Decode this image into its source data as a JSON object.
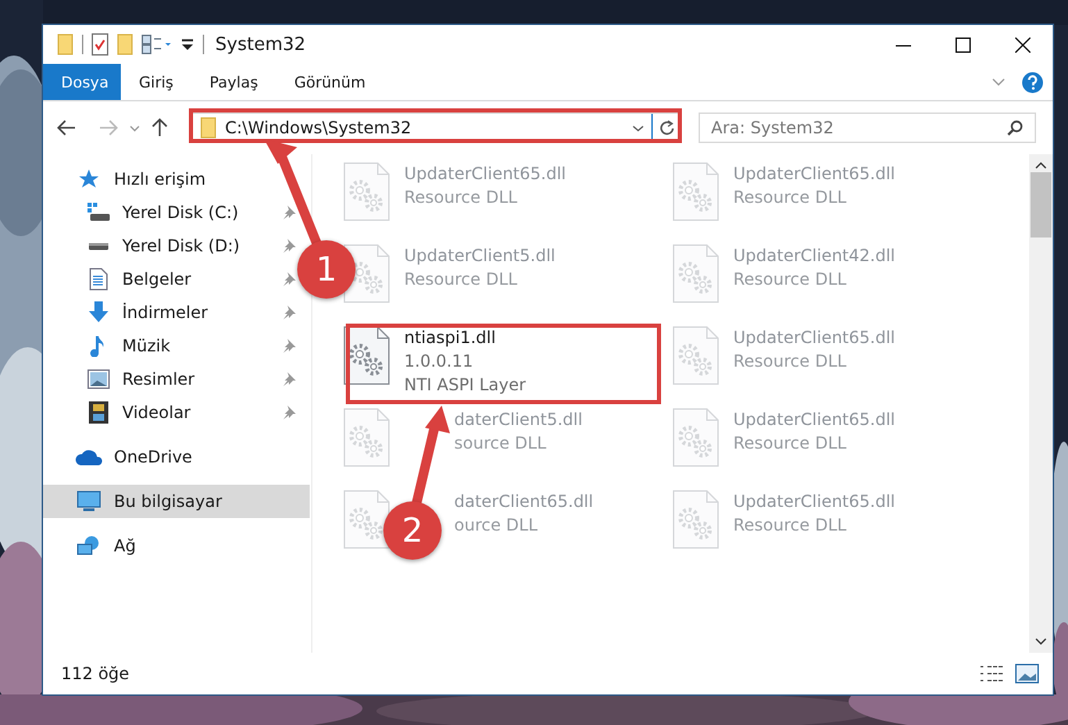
{
  "window": {
    "title": "System32"
  },
  "ribbon_tabs": [
    {
      "label": "Dosya",
      "selected": true
    },
    {
      "label": "Giriş",
      "selected": false
    },
    {
      "label": "Paylaş",
      "selected": false
    },
    {
      "label": "Görünüm",
      "selected": false
    }
  ],
  "address_bar": {
    "path": "C:\\Windows\\System32"
  },
  "search": {
    "placeholder": "Ara: System32"
  },
  "sidebar": {
    "items": [
      {
        "label": "Hızlı erişim",
        "kind": "star",
        "selected": false,
        "children": [
          {
            "label": "Yerel Disk (C:)",
            "kind": "system-drive",
            "pinned": true,
            "selected": false
          },
          {
            "label": "Yerel Disk (D:)",
            "kind": "drive",
            "pinned": true,
            "selected": false
          },
          {
            "label": "Belgeler",
            "kind": "documents",
            "pinned": true,
            "selected": false
          },
          {
            "label": "İndirmeler",
            "kind": "download",
            "pinned": true,
            "selected": false
          },
          {
            "label": "Müzik",
            "kind": "music",
            "pinned": true,
            "selected": false
          },
          {
            "label": "Resimler",
            "kind": "pictures",
            "pinned": true,
            "selected": false
          },
          {
            "label": "Videolar",
            "kind": "video",
            "pinned": true,
            "selected": false
          }
        ]
      },
      {
        "label": "OneDrive",
        "kind": "cloud",
        "selected": false
      },
      {
        "label": "Bu bilgisayar",
        "kind": "computer",
        "selected": true
      },
      {
        "label": "Ağ",
        "kind": "network",
        "selected": false
      }
    ]
  },
  "files": [
    {
      "name": "UpdaterClient65.dll",
      "description": "Resource DLL",
      "blurred": true,
      "covered": false
    },
    {
      "name": "UpdaterClient65.dll",
      "description": "Resource DLL",
      "blurred": true,
      "covered": false
    },
    {
      "name": "UpdaterClient5.dll",
      "description": "Resource DLL",
      "blurred": true,
      "covered": false
    },
    {
      "name": "UpdaterClient42.dll",
      "description": "Resource DLL",
      "blurred": true,
      "covered": false
    },
    {
      "name": "ntiaspi1.dll",
      "version": "1.0.0.11",
      "description": "NTI ASPI Layer",
      "blurred": false,
      "covered": false
    },
    {
      "name": "UpdaterClient65.dll",
      "description": "Resource DLL",
      "blurred": true,
      "covered": false
    },
    {
      "name": "daterClient5.dll",
      "description": "source DLL",
      "blurred": true,
      "covered": true
    },
    {
      "name": "UpdaterClient65.dll",
      "description": "Resource DLL",
      "blurred": true,
      "covered": false
    },
    {
      "name": "daterClient65.dll",
      "description": "ource DLL",
      "blurred": true,
      "covered": true
    },
    {
      "name": "UpdaterClient65.dll",
      "description": "Resource DLL",
      "blurred": true,
      "covered": false
    }
  ],
  "status_bar": {
    "item_count": "112 öğe"
  },
  "annotations": [
    {
      "label": "1"
    },
    {
      "label": "2"
    }
  ]
}
